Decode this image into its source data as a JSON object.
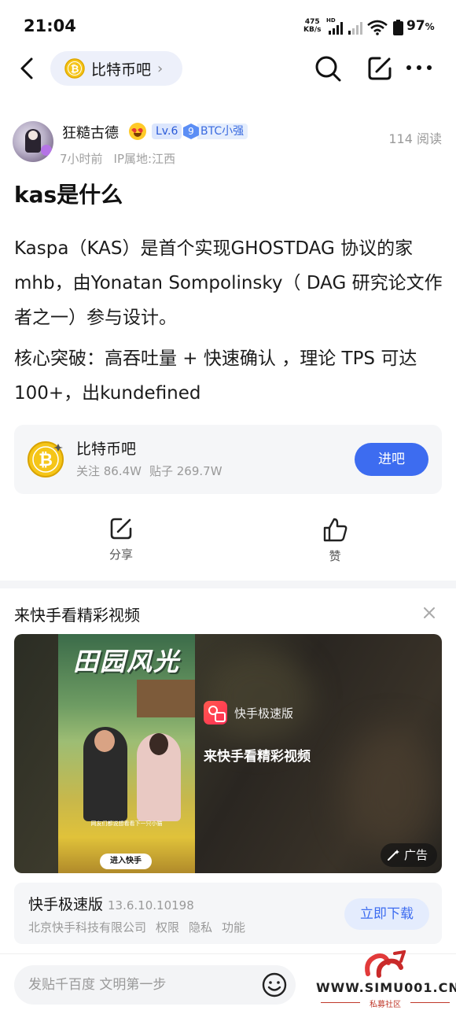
{
  "status_bar": {
    "time": "21:04",
    "net_speed": "475",
    "net_unit": "KB/s",
    "hd_label": "HD",
    "battery": "97",
    "battery_unit": "%"
  },
  "nav": {
    "forum_name": "比特币吧",
    "chevron": "›"
  },
  "author": {
    "name": "狂糙古德",
    "level": "Lv.6",
    "fan_level": "9",
    "fan_title": "BTC小强",
    "time_ago": "7小时前",
    "ip_location": "IP属地:江西",
    "views": "114 阅读"
  },
  "post": {
    "title": "kas是什么",
    "paragraphs": [
      "Kaspa（KAS）是首个实现GHOSTDAG 协议的家mhb，由Yonatan Sompolinsky（ DAG 研究论文作者之一）参与设计。",
      "核心突破：高吞吐量 + 快速确认 ，理论 TPS 可达 100+，出kundefined"
    ]
  },
  "forum_card": {
    "name": "比特币吧",
    "followers": "关注 86.4W",
    "posts": "贴子 269.7W",
    "join_label": "进吧"
  },
  "actions": {
    "share_label": "分享",
    "like_label": "赞"
  },
  "ad": {
    "heading": "来快手看精彩视频",
    "poster_title": "田园风光",
    "poster_caption": "网友们都说想看看下一只小猫",
    "poster_button": "进入快手",
    "brand": "快手极速版",
    "slogan": "来快手看精彩视频",
    "tag": "广告",
    "app_name": "快手极速版",
    "app_version": "13.6.10.10198",
    "developer": "北京快手科技有限公司",
    "permissions": "权限",
    "privacy": "隐私",
    "features": "功能",
    "download_label": "立即下载"
  },
  "bottom": {
    "reply_placeholder": "发贴千百度 文明第一步"
  },
  "watermark": {
    "url": "WWW.SIMU001.CN",
    "sub": "私募社区"
  },
  "colors": {
    "accent": "#3d6cf0",
    "level_badge_bg": "#dce6fd",
    "card_bg": "#f5f6f8",
    "watermark_red": "#c0392b"
  }
}
